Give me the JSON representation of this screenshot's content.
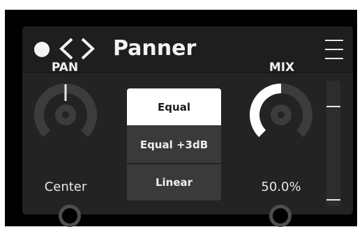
{
  "header": {
    "title": "Panner",
    "power_icon": "power-dot-icon",
    "prev_icon": "chevron-left-icon",
    "next_icon": "chevron-right-icon",
    "menu_icon": "hamburger-menu-icon"
  },
  "pan": {
    "label": "PAN",
    "value_text": "Center",
    "level": 0.5
  },
  "mix": {
    "label": "MIX",
    "value_text": "50.0%",
    "level": 0.5
  },
  "pan_law": {
    "options": [
      "Equal",
      "Equal +3dB",
      "Linear"
    ],
    "selected": "Equal"
  },
  "colors": {
    "background": "#000000",
    "panel": "#232323",
    "accent": "#ffffff",
    "knob_track": "#3c3c3c"
  }
}
